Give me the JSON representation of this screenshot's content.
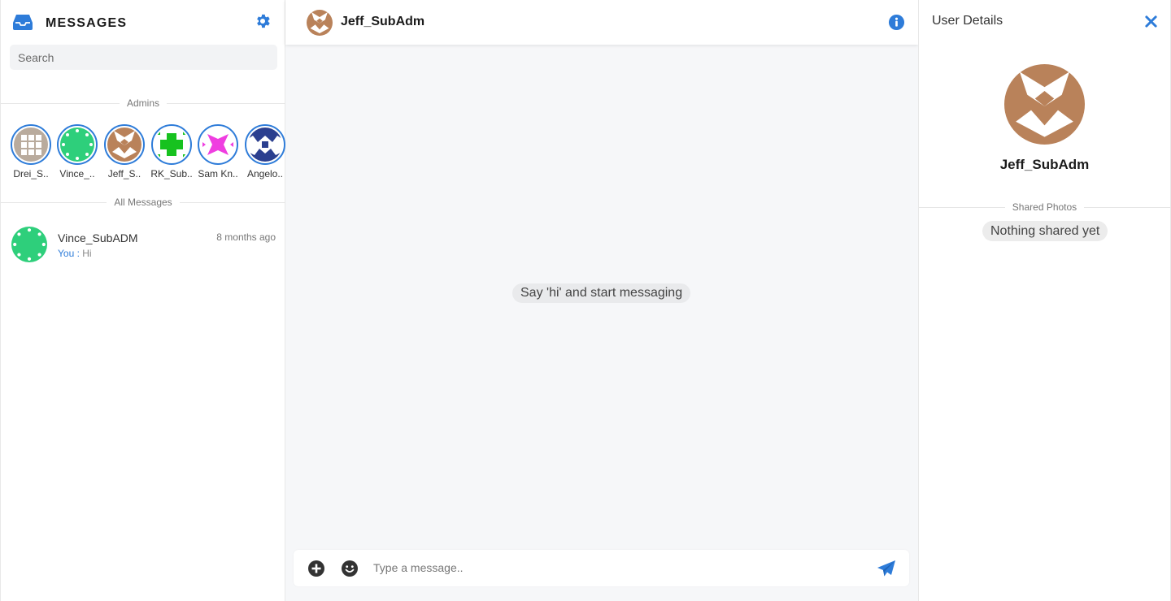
{
  "sidebar": {
    "title": "MESSAGES",
    "search_placeholder": "Search",
    "admins_label": "Admins",
    "all_messages_label": "All Messages",
    "admins": [
      {
        "name": "Drei_S..",
        "color": "#b9ab9d"
      },
      {
        "name": "Vince_..",
        "color": "#2ecf7b"
      },
      {
        "name": "Jeff_S..",
        "color": "#b9825a"
      },
      {
        "name": "RK_Sub..",
        "color": "#17c21f"
      },
      {
        "name": "Sam Kn..",
        "color": "#ef3ee0"
      },
      {
        "name": "Angelo..",
        "color": "#2b3f8f"
      }
    ],
    "conversations": [
      {
        "name": "Vince_SubADM",
        "time": "8 months ago",
        "sender": "You :",
        "preview": "Hi",
        "color": "#2ecf7b"
      }
    ]
  },
  "chat": {
    "contact_name": "Jeff_SubAdm",
    "empty_text": "Say 'hi' and start messaging",
    "input_placeholder": "Type a message..",
    "icons": {
      "attach": "plus-circle-icon",
      "emoji": "smiley-icon",
      "send": "paper-plane-icon",
      "info": "info-circle-icon"
    }
  },
  "details": {
    "title": "User Details",
    "name": "Jeff_SubAdm",
    "shared_photos_label": "Shared Photos",
    "nothing_shared": "Nothing shared yet"
  },
  "colors": {
    "accent": "#2e7cd9",
    "jeff_avatar": "#b9825a",
    "background": "#f6f7f9"
  }
}
